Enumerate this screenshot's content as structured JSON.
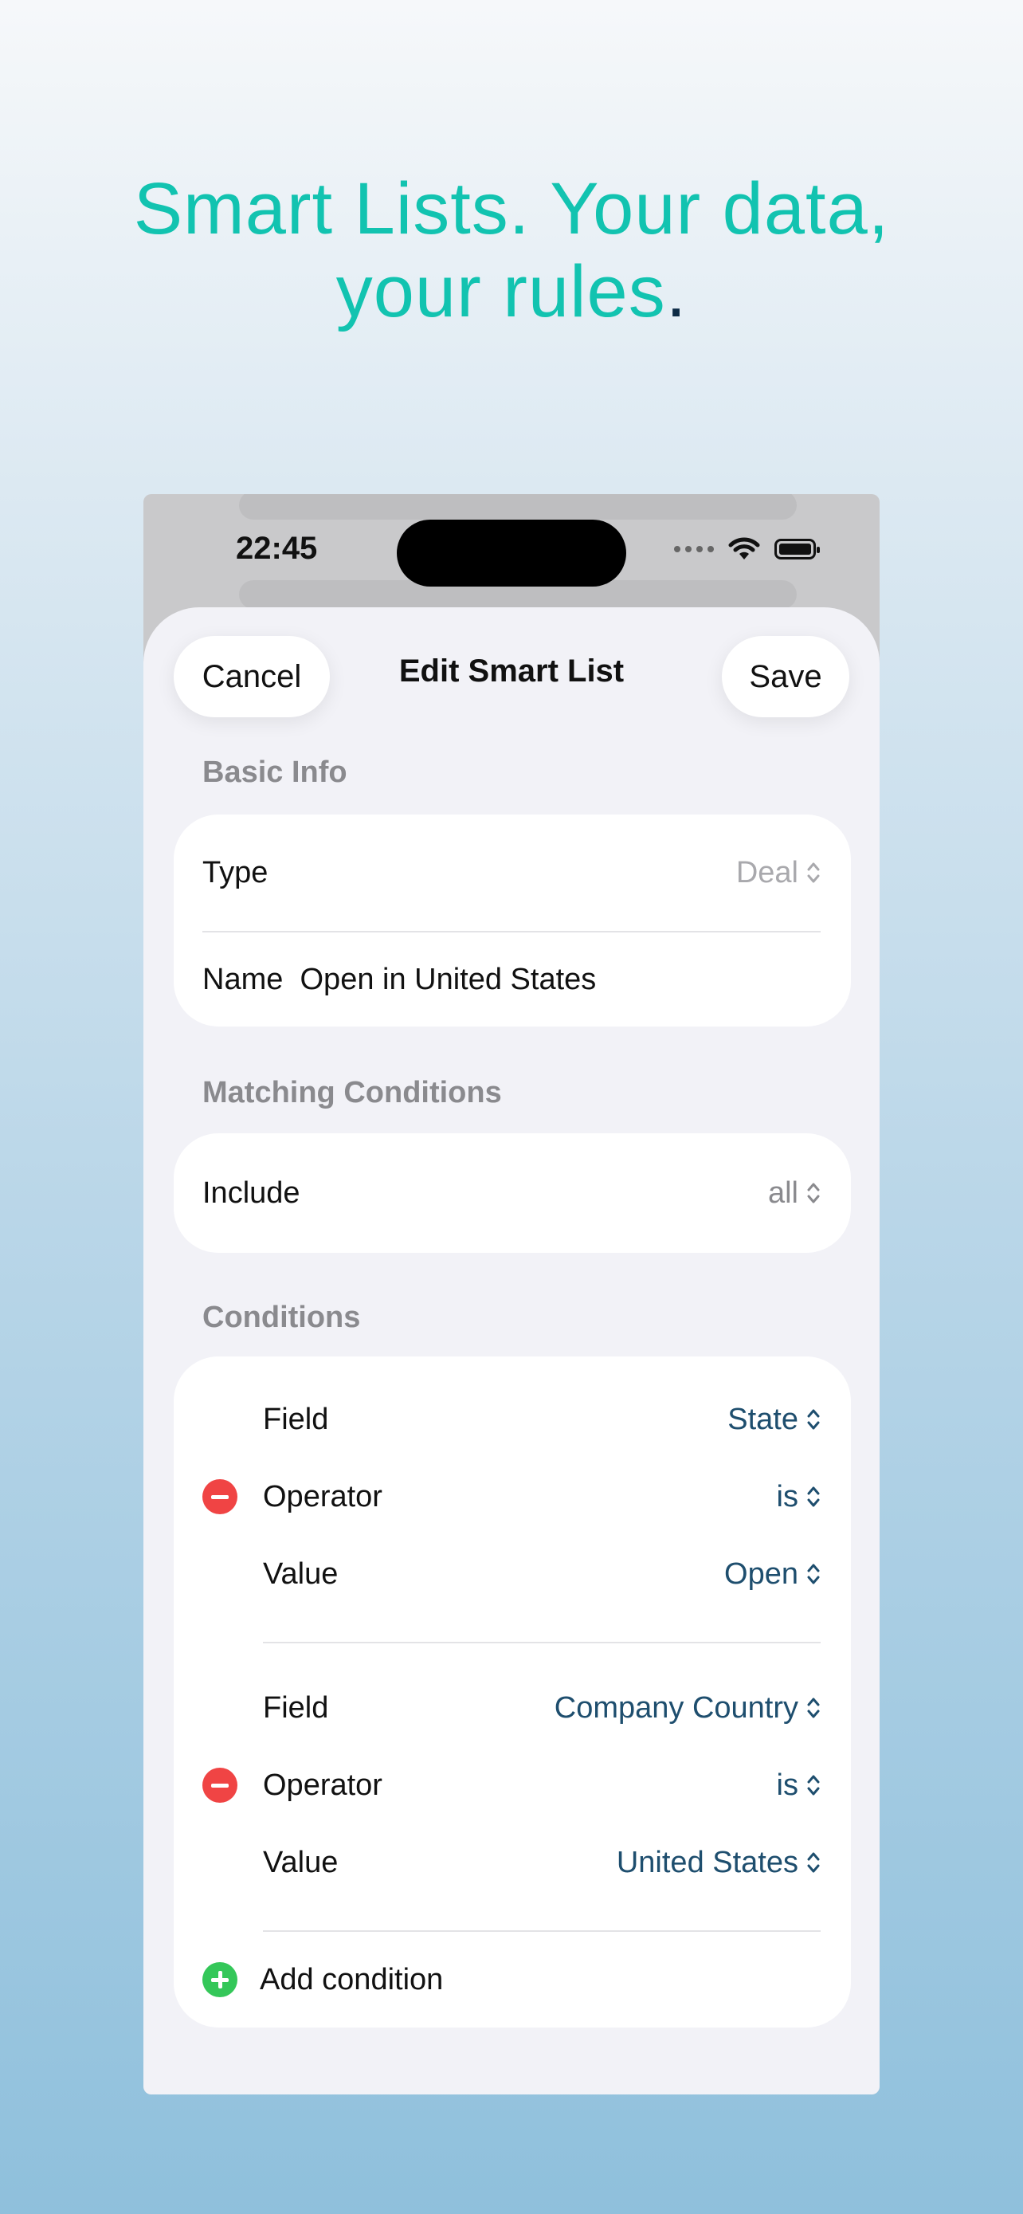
{
  "headline": {
    "line1": "Smart Lists. Your data,",
    "line2": "your rules",
    "dot": "."
  },
  "status_bar": {
    "time": "22:45"
  },
  "sheet": {
    "title": "Edit Smart List",
    "cancel_label": "Cancel",
    "save_label": "Save"
  },
  "basic_info": {
    "header": "Basic Info",
    "type_label": "Type",
    "type_value": "Deal",
    "name_label": "Name",
    "name_value": "Open in United States"
  },
  "matching": {
    "header": "Matching Conditions",
    "include_label": "Include",
    "include_value": "all"
  },
  "conditions": {
    "header": "Conditions",
    "items": [
      {
        "field_label": "Field",
        "field_value": "State",
        "operator_label": "Operator",
        "operator_value": "is",
        "value_label": "Value",
        "value_value": "Open"
      },
      {
        "field_label": "Field",
        "field_value": "Company Country",
        "operator_label": "Operator",
        "operator_value": "is",
        "value_label": "Value",
        "value_value": "United States"
      }
    ],
    "add_label": "Add condition"
  },
  "colors": {
    "accent": "#12c3b0",
    "link": "#1e4e6e",
    "remove": "#f04444",
    "add": "#34c759"
  }
}
